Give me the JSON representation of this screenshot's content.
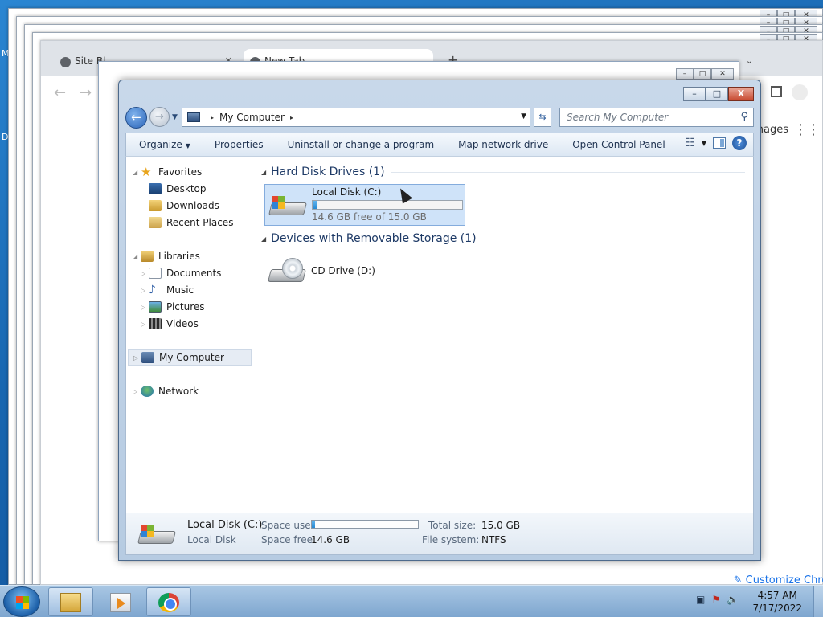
{
  "desktop": {
    "left_fragment_1": "M",
    "left_fragment_2": "D"
  },
  "background_browser": {
    "tabs": [
      {
        "label": "Site Bl..."
      },
      {
        "label": "New Tab"
      }
    ],
    "fragments": {
      "right_link": "nages",
      "customize_label": "Customize Chrome"
    }
  },
  "explorer": {
    "title_buttons": {
      "minimize": "–",
      "maximize": "□",
      "close": "X"
    },
    "address": {
      "location": "My Computer",
      "separator": "▸"
    },
    "search": {
      "placeholder": "Search My Computer"
    },
    "toolbar": {
      "organize": "Organize",
      "properties": "Properties",
      "uninstall": "Uninstall or change a program",
      "map_drive": "Map network drive",
      "control_panel": "Open Control Panel"
    },
    "nav": {
      "favorites": "Favorites",
      "desktop": "Desktop",
      "downloads": "Downloads",
      "recent": "Recent Places",
      "libraries": "Libraries",
      "documents": "Documents",
      "music": "Music",
      "pictures": "Pictures",
      "videos": "Videos",
      "computer": "My Computer",
      "network": "Network"
    },
    "groups": {
      "hdd": "Hard Disk Drives (1)",
      "removable": "Devices with Removable Storage (1)"
    },
    "drives": {
      "c": {
        "name": "Local Disk (C:)",
        "free_text": "14.6 GB free of 15.0 GB",
        "used_fraction": 0.027
      },
      "d": {
        "name": "CD Drive (D:)"
      }
    },
    "details": {
      "name": "Local Disk (C:)",
      "type": "Local Disk",
      "space_used_label": "Space used:",
      "space_free_label": "Space free:",
      "space_free_value": "14.6 GB",
      "total_size_label": "Total size:",
      "total_size_value": "15.0 GB",
      "file_system_label": "File system:",
      "file_system_value": "NTFS",
      "used_fraction": 0.027
    }
  },
  "taskbar": {
    "time": "4:57 AM",
    "date": "7/17/2022"
  },
  "colors": {
    "accent": "#2789d2",
    "selection": "#cfe3f9",
    "taskbar": "#7ea6cf"
  }
}
